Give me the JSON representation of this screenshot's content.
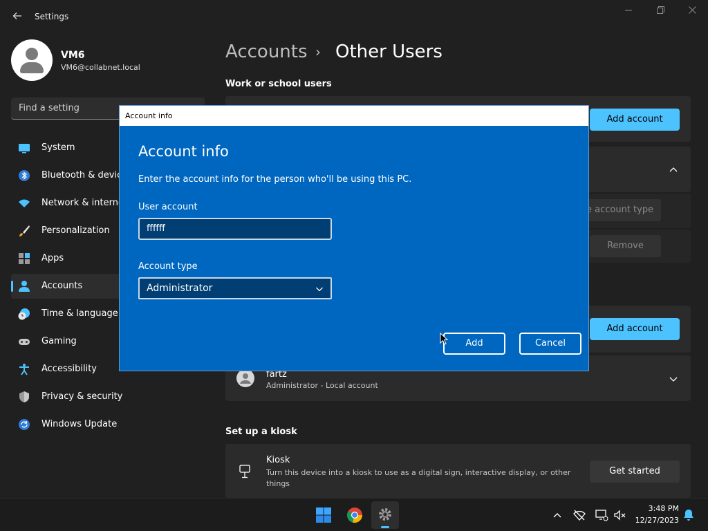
{
  "window": {
    "title": "Settings"
  },
  "profile": {
    "name": "VM6",
    "email": "VM6@collabnet.local"
  },
  "search": {
    "placeholder": "Find a setting"
  },
  "nav": {
    "items": [
      {
        "label": "System",
        "icon": "system-icon"
      },
      {
        "label": "Bluetooth & devices",
        "icon": "bluetooth-icon"
      },
      {
        "label": "Network & internet",
        "icon": "wifi-icon"
      },
      {
        "label": "Personalization",
        "icon": "brush-icon"
      },
      {
        "label": "Apps",
        "icon": "apps-icon"
      },
      {
        "label": "Accounts",
        "icon": "accounts-icon"
      },
      {
        "label": "Time & language",
        "icon": "time-language-icon"
      },
      {
        "label": "Gaming",
        "icon": "gaming-icon"
      },
      {
        "label": "Accessibility",
        "icon": "accessibility-icon"
      },
      {
        "label": "Privacy & security",
        "icon": "shield-icon"
      },
      {
        "label": "Windows Update",
        "icon": "update-icon"
      }
    ],
    "active": "Accounts"
  },
  "breadcrumb": {
    "parent": "Accounts",
    "separator": "›",
    "current": "Other Users"
  },
  "work_school": {
    "title": "Work or school users",
    "add_button": "Add account"
  },
  "hidden_row": {
    "change_type": "e account type",
    "remove": "Remove"
  },
  "other_users": {
    "add_button": "Add account",
    "user": {
      "name": "fartz",
      "detail": "Administrator - Local account"
    }
  },
  "kiosk": {
    "title": "Set up a kiosk",
    "name": "Kiosk",
    "description_line1": "Turn this device into a kiosk to use as a digital sign, interactive display, or other",
    "description_line2": "things",
    "button": "Get started"
  },
  "dialog": {
    "window_title": "Account info",
    "heading": "Account info",
    "description": "Enter the account info for the person who'll be using this PC.",
    "user_account_label": "User account",
    "user_account_value": "ffffff",
    "account_type_label": "Account type",
    "account_type_value": "Administrator",
    "add_button": "Add",
    "cancel_button": "Cancel"
  },
  "taskbar": {
    "time": "3:48 PM",
    "date": "12/27/2023"
  },
  "colors": {
    "accent": "#4cc2ff",
    "dialog_bg": "#0067c0",
    "background": "#202020"
  }
}
